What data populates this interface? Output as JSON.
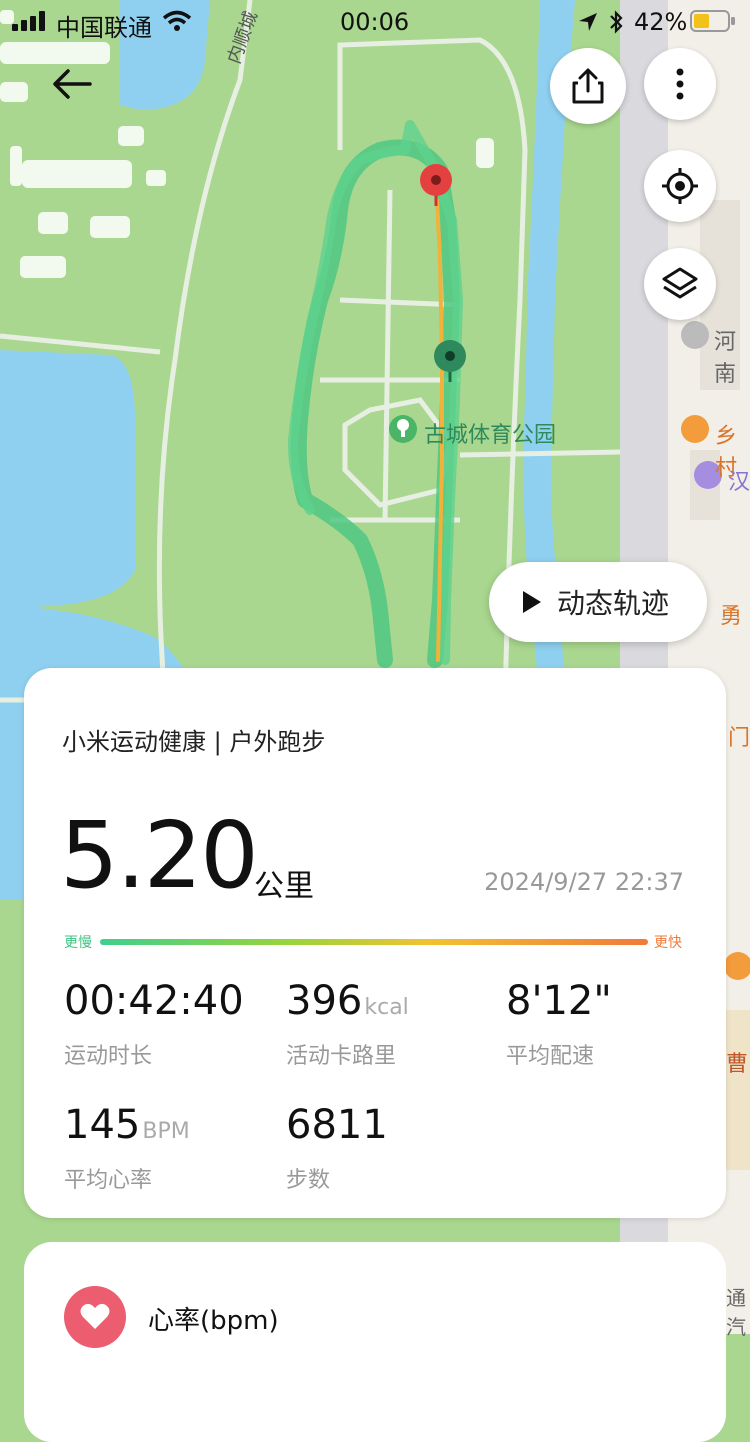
{
  "status_bar": {
    "carrier": "中国联通",
    "time": "00:06",
    "battery": "42%"
  },
  "map": {
    "labels": {
      "road": "内顺城",
      "park": "古城体育公园",
      "poi_1": "河南",
      "poi_2": "乡村",
      "poi_3": "汉",
      "poi_4": "勇",
      "poi_5": "门",
      "poi_6": "曹",
      "poi_7": "通汽"
    }
  },
  "controls": {
    "replay_label": "动态轨迹"
  },
  "summary": {
    "app_line": "小米运动健康 | 户外跑步",
    "distance": "5.20",
    "distance_unit": "公里",
    "datetime": "2024/9/27 22:37",
    "pace_scale": {
      "slow": "更慢",
      "fast": "更快"
    },
    "stats": [
      {
        "value": "00:42:40",
        "unit": "",
        "label": "运动时长"
      },
      {
        "value": "396",
        "unit": "kcal",
        "label": "活动卡路里"
      },
      {
        "value": "8'12\"",
        "unit": "",
        "label": "平均配速"
      },
      {
        "value": "145",
        "unit": "BPM",
        "label": "平均心率"
      },
      {
        "value": "6811",
        "unit": "",
        "label": "步数"
      }
    ]
  },
  "heart_section": {
    "title": "心率(bpm)"
  },
  "colors": {
    "route": "#4fc883",
    "route_fast": "#f0b23a",
    "start_pin": "#2e8a5c",
    "end_pin": "#e54040",
    "water": "#8fd0f0",
    "park": "#a9d78f"
  }
}
